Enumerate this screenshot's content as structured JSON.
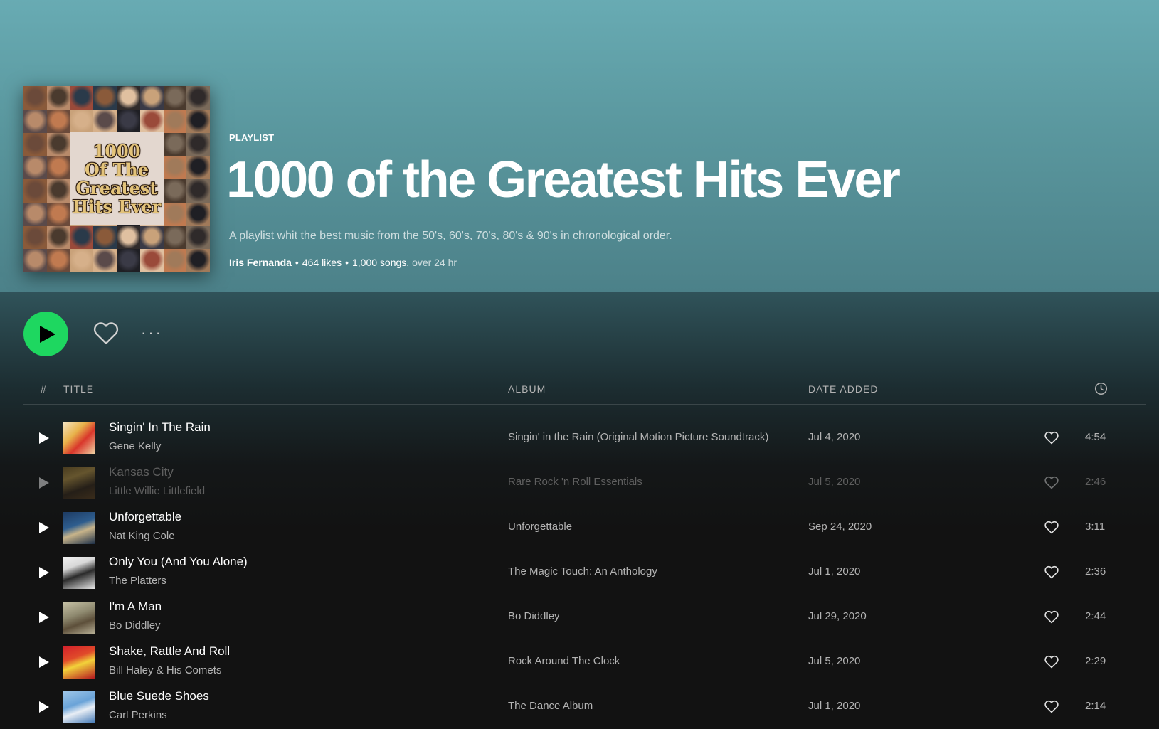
{
  "playlist": {
    "type_label": "PLAYLIST",
    "title": "1000 of the Greatest Hits Ever",
    "description": "A playlist whit the best music from the 50's, 60's, 70's, 80's & 90's in chronological order.",
    "owner": "Iris Fernanda",
    "likes": "464 likes",
    "songs": "1,000 songs,",
    "duration": "over 24 hr",
    "separator": "•",
    "cover_text": [
      "1000",
      "Of The",
      "Greatest",
      "Hits Ever"
    ]
  },
  "controls": {
    "more_label": "···",
    "play_color": "#1ed760"
  },
  "table_header": {
    "num": "#",
    "title": "TITLE",
    "album": "ALBUM",
    "date_added": "DATE ADDED",
    "duration_icon": "clock-icon"
  },
  "tracks": [
    {
      "title": "Singin' In The Rain",
      "artist": "Gene Kelly",
      "album": "Singin' in the Rain (Original Motion Picture Soundtrack)",
      "date_added": "Jul 4, 2020",
      "duration": "4:54",
      "available": true
    },
    {
      "title": "Kansas City",
      "artist": "Little Willie Littlefield",
      "album": "Rare Rock 'n Roll Essentials",
      "date_added": "Jul 5, 2020",
      "duration": "2:46",
      "available": false
    },
    {
      "title": "Unforgettable",
      "artist": "Nat King Cole",
      "album": "Unforgettable",
      "date_added": "Sep 24, 2020",
      "duration": "3:11",
      "available": true
    },
    {
      "title": "Only You (And You Alone)",
      "artist": "The Platters",
      "album": "The Magic Touch: An Anthology",
      "date_added": "Jul 1, 2020",
      "duration": "2:36",
      "available": true
    },
    {
      "title": "I'm A Man",
      "artist": "Bo Diddley",
      "album": "Bo Diddley",
      "date_added": "Jul 29, 2020",
      "duration": "2:44",
      "available": true
    },
    {
      "title": "Shake, Rattle And Roll",
      "artist": "Bill Haley & His Comets",
      "album": "Rock Around The Clock",
      "date_added": "Jul 5, 2020",
      "duration": "2:29",
      "available": true
    },
    {
      "title": "Blue Suede Shoes",
      "artist": "Carl Perkins",
      "album": "The Dance Album",
      "date_added": "Jul 1, 2020",
      "duration": "2:14",
      "available": true
    }
  ]
}
